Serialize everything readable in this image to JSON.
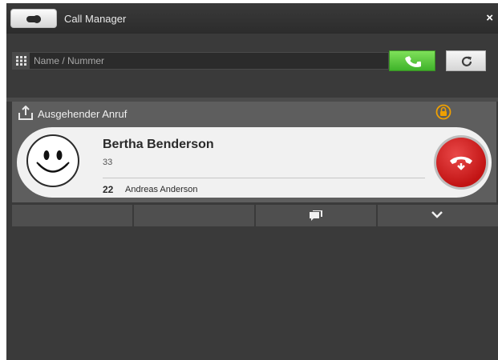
{
  "window": {
    "title": "Call Manager",
    "close_glyph": "×"
  },
  "search": {
    "placeholder": "Name / Nummer",
    "value": ""
  },
  "call": {
    "direction_label": "Ausgehender Anruf",
    "contact_name": "Bertha Benderson",
    "contact_number": "33",
    "line_number": "22",
    "line_name": "Andreas Anderson"
  },
  "icons": {
    "toggle": "toggle-switch-icon",
    "keypad": "keypad-icon",
    "call": "phone-handset-icon",
    "refresh": "refresh-icon",
    "outgoing": "outgoing-call-icon",
    "lock": "lock-icon",
    "avatar": "smiley-avatar-icon",
    "hangup": "hang-up-icon",
    "chat": "chat-icon",
    "expand": "chevron-down-icon"
  },
  "colors": {
    "call_button": "#4cc934",
    "hangup_button": "#d01818",
    "lock_accent": "#f0a000",
    "background": "#3a3a3a"
  }
}
